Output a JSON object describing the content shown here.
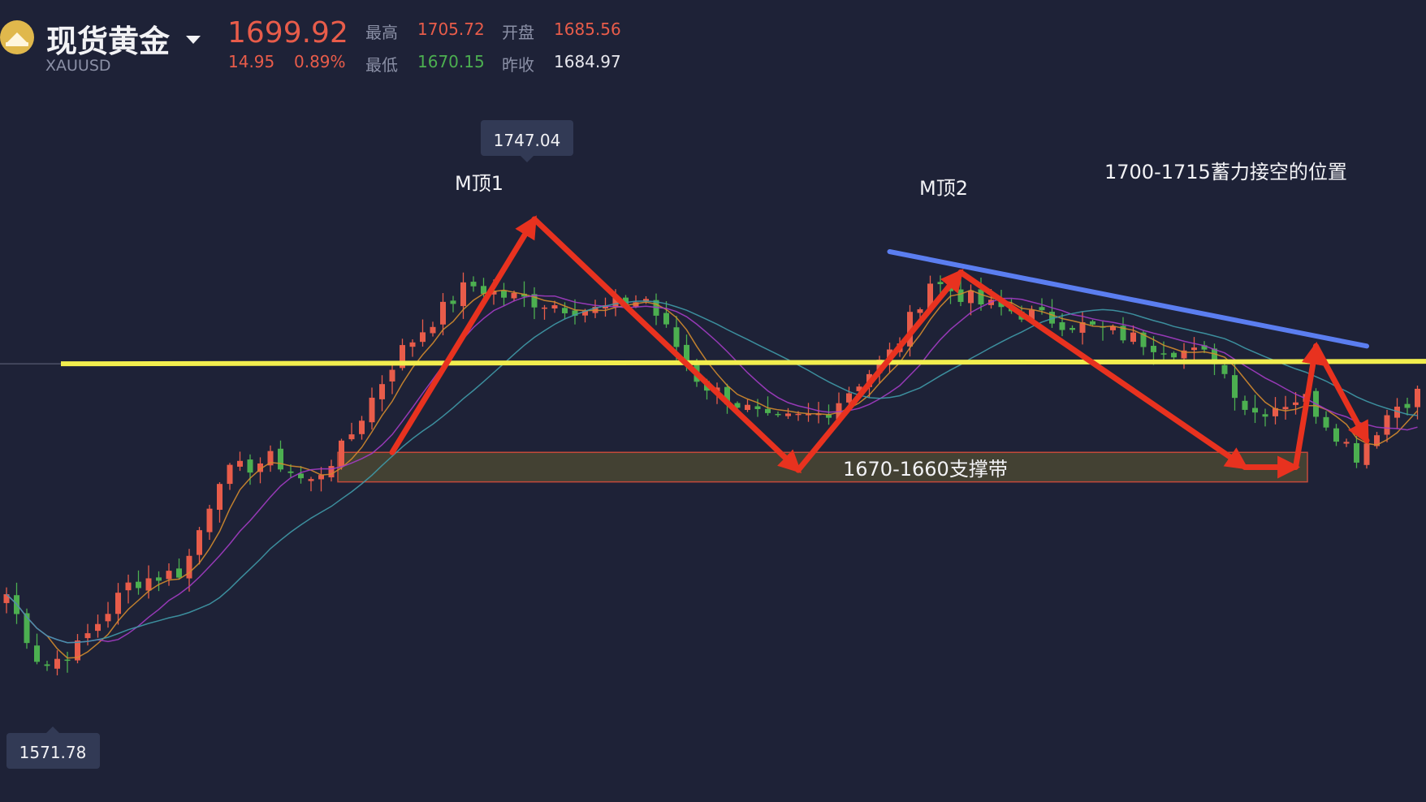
{
  "header": {
    "name": "现货黄金",
    "code": "XAUUSD",
    "price": "1699.92",
    "change": "14.95",
    "change_pct": "0.89%",
    "high_label": "最高",
    "high": "1705.72",
    "low_label": "最低",
    "low": "1670.15",
    "open_label": "开盘",
    "open": "1685.56",
    "prev_label": "昨收",
    "prev_close": "1684.97"
  },
  "colors": {
    "background": "#1e2237",
    "up": "#e85c4a",
    "down": "#4caf50",
    "ma_fast": "#d38b2e",
    "ma_mid": "#a33cc4",
    "ma_slow": "#3f9aa8",
    "arrows": "#e8321f",
    "trendline": "#5b7ef0",
    "support_line": "#f2ee4e",
    "support_band": "#4a4733"
  },
  "chart_data": {
    "type": "candlestick",
    "symbol": "XAUUSD",
    "ylim": [
      1562,
      1782
    ],
    "n_candles": 140,
    "max_marker": "1747.04",
    "min_marker": "1571.78",
    "horizontal_line": 1700,
    "support_band": [
      1660,
      1670
    ],
    "descending_trendline": [
      [
        87,
        1738
      ],
      [
        134,
        1706
      ]
    ],
    "arrow_path": [
      [
        38,
        1670
      ],
      [
        52,
        1749
      ],
      [
        78,
        1664
      ],
      [
        94,
        1731
      ],
      [
        122,
        1665
      ],
      [
        127,
        1665
      ],
      [
        129,
        1706
      ],
      [
        134,
        1674
      ]
    ],
    "annotations": {
      "m_top_1": "M顶1",
      "m_top_2": "M顶2",
      "short_zone": "1700-1715蓄力接空的位置",
      "support_zone": "1670-1660支撑带"
    },
    "indicators": [
      "MA-fast",
      "MA-mid",
      "MA-slow"
    ]
  }
}
